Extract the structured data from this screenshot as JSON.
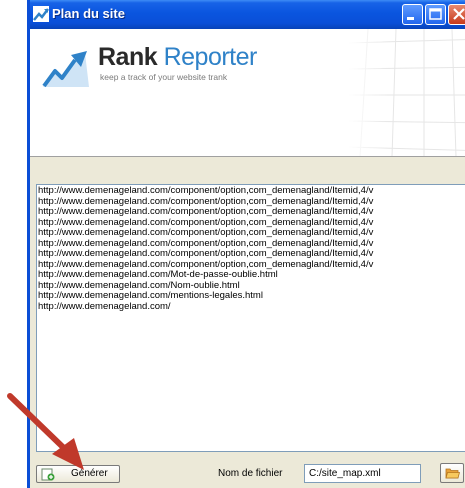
{
  "window": {
    "title": "Plan du site",
    "title_icon": "chart-icon",
    "buttons": [
      "minimize-icon",
      "maximize-icon",
      "close-icon"
    ]
  },
  "banner": {
    "brand_main": "Rank",
    "brand_accent": "Reporter",
    "tagline": "keep a track of your website trank"
  },
  "url_list": {
    "items": [
      "http://www.demenageland.com/component/option,com_demenagland/Itemid,4/v",
      "http://www.demenageland.com/component/option,com_demenagland/Itemid,4/v",
      "http://www.demenageland.com/component/option,com_demenagland/Itemid,4/v",
      "http://www.demenageland.com/component/option,com_demenagland/Itemid,4/v",
      "http://www.demenageland.com/component/option,com_demenagland/Itemid,4/v",
      "http://www.demenageland.com/component/option,com_demenagland/Itemid,4/v",
      "http://www.demenageland.com/component/option,com_demenagland/Itemid,4/v",
      "http://www.demenageland.com/component/option,com_demenagland/Itemid,4/v",
      "http://www.demenageland.com/Mot-de-passe-oublie.html",
      "http://www.demenageland.com/Nom-oublie.html",
      "http://www.demenageland.com/mentions-legales.html",
      "http://www.demenageland.com/"
    ]
  },
  "footer": {
    "generate_label": "Générer",
    "generate_icon": "add-page-icon",
    "filename_label": "Nom de fichier",
    "filename_value": "C:/site_map.xml",
    "browse_icon": "folder-open-icon"
  },
  "colors": {
    "titlebar": "#0a55df",
    "brand_accent": "#2f82c8",
    "annotation_arrow": "#c0392b"
  }
}
